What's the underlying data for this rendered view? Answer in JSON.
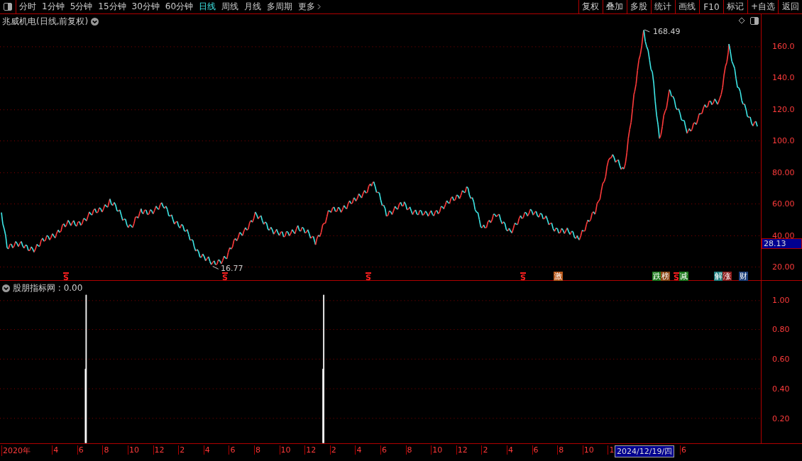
{
  "toolbar": {
    "periods": [
      {
        "label": "分时",
        "selected": false
      },
      {
        "label": "1分钟",
        "selected": false
      },
      {
        "label": "5分钟",
        "selected": false
      },
      {
        "label": "15分钟",
        "selected": false
      },
      {
        "label": "30分钟",
        "selected": false
      },
      {
        "label": "60分钟",
        "selected": false
      },
      {
        "label": "日线",
        "selected": true
      },
      {
        "label": "周线",
        "selected": false
      },
      {
        "label": "月线",
        "selected": false
      },
      {
        "label": "多周期",
        "selected": false
      }
    ],
    "more": "更多",
    "buttons": [
      "复权",
      "叠加",
      "多股",
      "统计",
      "画线",
      "F10",
      "标记",
      "+自选",
      "返回"
    ]
  },
  "chart": {
    "title": "兆威机电(日线,前复权)",
    "y_ticks": [
      "160.0",
      "140.0",
      "120.0",
      "100.0",
      "80.00",
      "60.00",
      "40.00",
      "20.00"
    ],
    "price_tag": "28.13",
    "high_label": "168.49",
    "low_label": "16.77",
    "markers": [
      {
        "kind": "s",
        "label": "S"
      },
      {
        "kind": "s",
        "label": "S"
      },
      {
        "kind": "s",
        "label": "S"
      },
      {
        "kind": "s",
        "label": "S"
      },
      {
        "kind": "tag",
        "label": "激",
        "color": "#b8581a"
      },
      {
        "kind": "tag",
        "label": "跌",
        "color": "#1e7a1e"
      },
      {
        "kind": "tag",
        "label": "榜",
        "color": "#8b4513"
      },
      {
        "kind": "s",
        "label": "S"
      },
      {
        "kind": "tag",
        "label": "减",
        "color": "#1e7a1e"
      },
      {
        "kind": "tag",
        "label": "解",
        "color": "#1e7f80"
      },
      {
        "kind": "tag",
        "label": "涨",
        "color": "#8b1a1a"
      },
      {
        "kind": "tag",
        "label": "财",
        "color": "#1c3f7a"
      }
    ]
  },
  "indicator": {
    "title": "股朋指标网 : 0.00",
    "y_ticks": [
      "1.00",
      "0.80",
      "0.60",
      "0.40",
      "0.20"
    ]
  },
  "time_axis": {
    "labels": [
      "2020年",
      "4",
      "6",
      "8",
      "10",
      "12",
      "2",
      "4",
      "6",
      "8",
      "10",
      "12",
      "2",
      "4",
      "6",
      "8",
      "10",
      "12",
      "2",
      "4",
      "6",
      "8",
      "10",
      "1"
    ],
    "cursor_date": "2024/12/19/四",
    "after": "6"
  }
}
